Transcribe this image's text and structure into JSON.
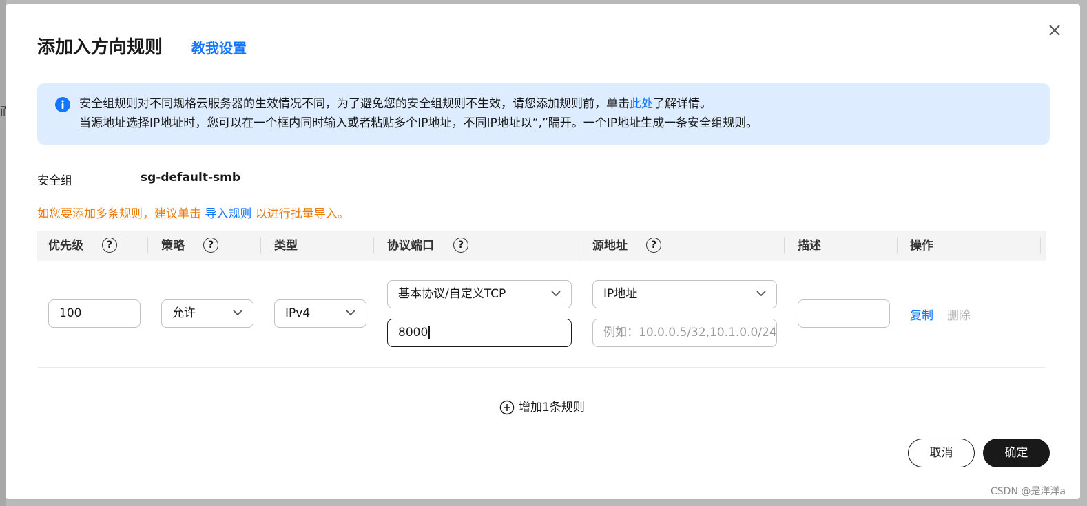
{
  "background": {
    "partial_glyph": "而"
  },
  "dialog": {
    "title": "添加入方向规则",
    "teach_link": "教我设置"
  },
  "notice": {
    "line1_prefix": "安全组规则对不同规格云服务器的生效情况不同，为了避免您的安全组规则不生效，请您添加规则前，单击",
    "line1_link": "此处",
    "line1_suffix": "了解详情。",
    "line2": "当源地址选择IP地址时，您可以在一个框内同时输入或者粘贴多个IP地址，不同IP地址以“,”隔开。一个IP地址生成一条安全组规则。"
  },
  "security_group": {
    "label": "安全组",
    "value": "sg-default-smb"
  },
  "tip": {
    "prefix": "如您要添加多条规则，建议单击",
    "link": "导入规则",
    "suffix": "以进行批量导入。"
  },
  "table": {
    "headers": {
      "priority": "优先级",
      "policy": "策略",
      "type": "类型",
      "protocol_port": "协议端口",
      "source": "源地址",
      "description": "描述",
      "action": "操作"
    },
    "help_glyph": "?",
    "row": {
      "priority": "100",
      "policy": "允许",
      "type": "IPv4",
      "protocol": "基本协议/自定义TCP",
      "port": "8000",
      "source_type": "IP地址",
      "source_placeholder": "例如：10.0.0.5/32,10.1.0.0/24",
      "description": "",
      "copy": "复制",
      "delete": "删除"
    }
  },
  "add_rule": "增加1条规则",
  "buttons": {
    "cancel": "取消",
    "confirm": "确定"
  },
  "watermark": "CSDN @是洋洋a",
  "icons": {
    "close": "close-icon",
    "info": "info-icon",
    "help": "help-icon",
    "chevron": "chevron-down-icon",
    "add": "plus-circle-icon"
  },
  "colors": {
    "link": "#1476ff",
    "tip": "#ed7b0b",
    "notice_bg": "#deecff",
    "primary_button": "#191919"
  }
}
